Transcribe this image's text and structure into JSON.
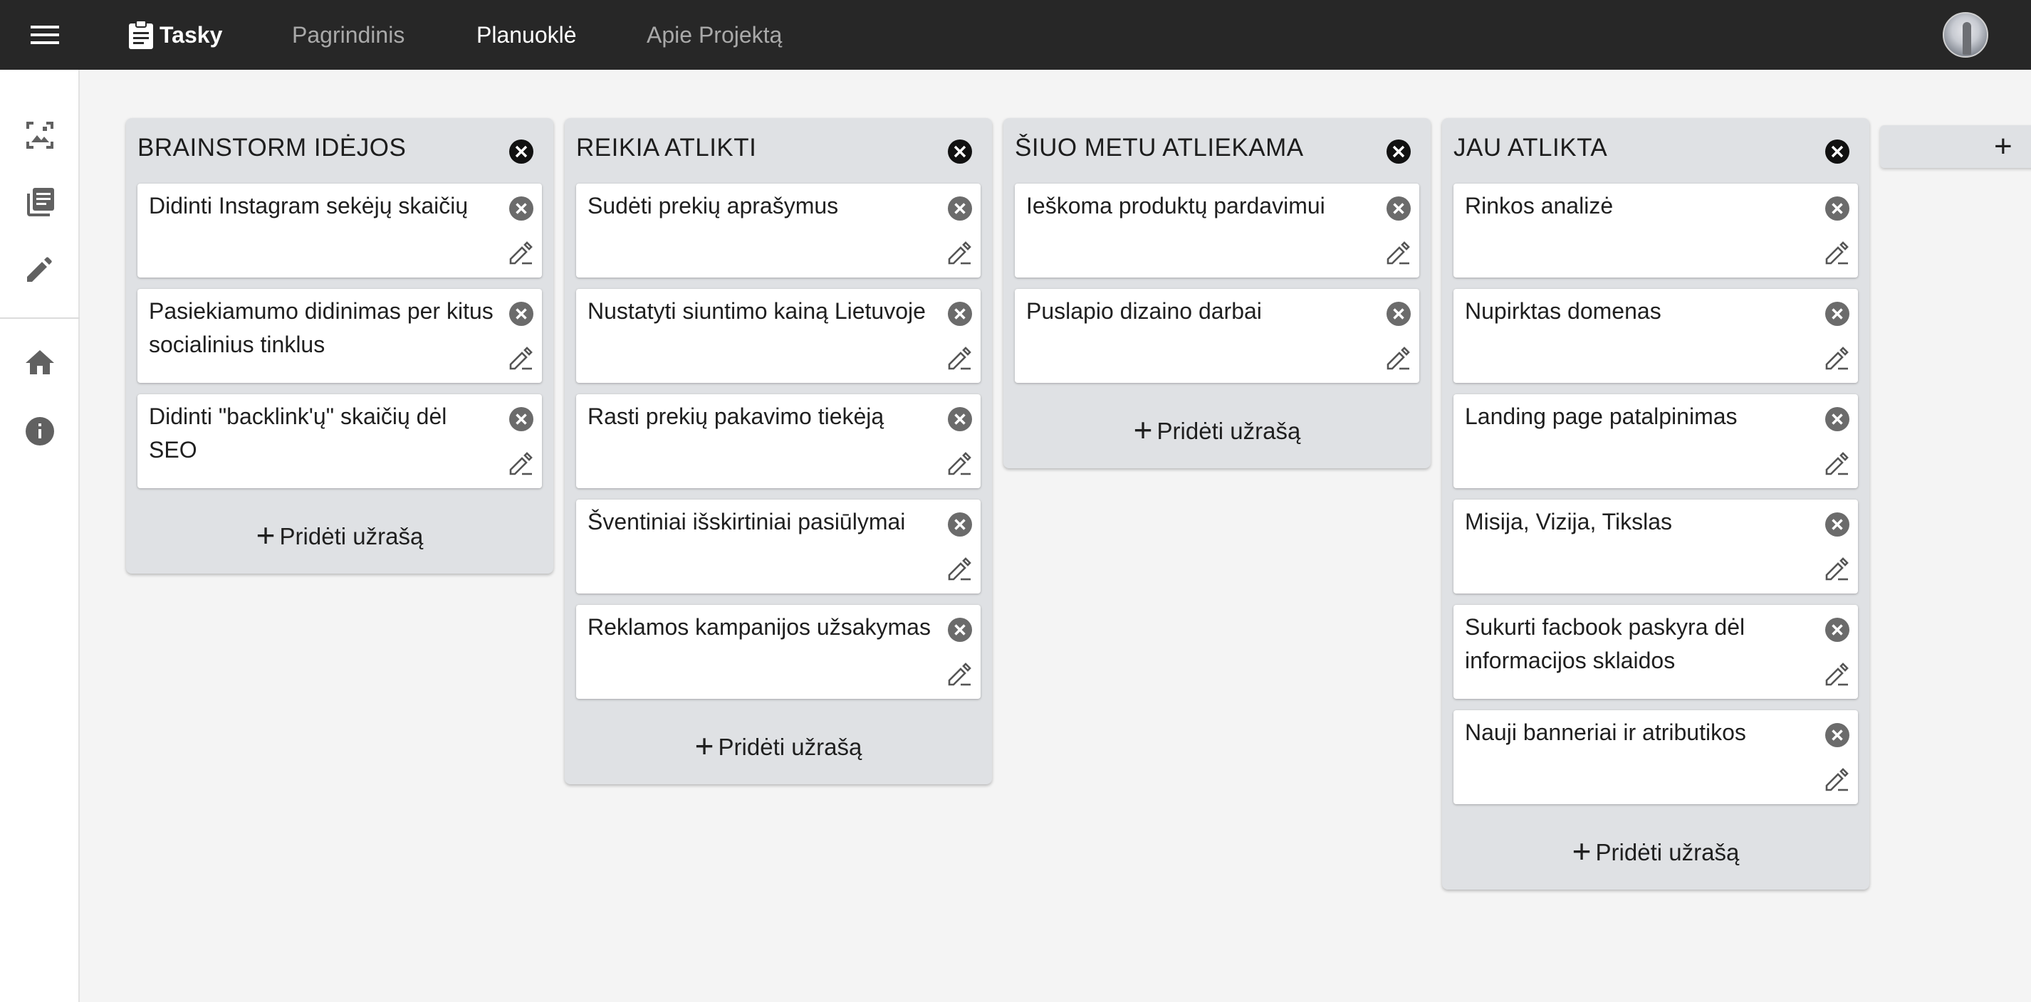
{
  "app": {
    "title": "Tasky"
  },
  "nav": [
    {
      "label": "Pagrindinis",
      "active": false
    },
    {
      "label": "Planuoklė",
      "active": true
    },
    {
      "label": "Apie Projektą",
      "active": false
    }
  ],
  "sidebar": {
    "items": [
      {
        "icon": "image-frame-icon"
      },
      {
        "icon": "library-books-icon"
      },
      {
        "icon": "pencil-icon"
      },
      {
        "icon": "home-icon"
      },
      {
        "icon": "info-icon"
      }
    ]
  },
  "board": {
    "add_note_label": "Pridėti užrašą",
    "add_column_label": "+",
    "columns": [
      {
        "title": "BRAINSTORM IDĖJOS",
        "cards": [
          "Didinti Instagram sekėjų skaičių",
          "Pasiekiamumo didinimas per kitus socialinius tinklus",
          "Didinti \"backlink'ų\" skaičių dėl SEO"
        ]
      },
      {
        "title": "REIKIA ATLIKTI",
        "cards": [
          "Sudėti prekių aprašymus",
          "Nustatyti siuntimo kainą Lietuvoje",
          "Rasti prekių pakavimo tiekėją",
          "Šventiniai išskirtiniai pasiūlymai",
          "Reklamos kampanijos užsakymas"
        ]
      },
      {
        "title": "ŠIUO METU ATLIEKAMA",
        "cards": [
          "Ieškoma produktų pardavimui",
          "Puslapio dizaino darbai"
        ]
      },
      {
        "title": "JAU ATLIKTA",
        "cards": [
          "Rinkos analizė",
          "Nupirktas domenas",
          "Landing page patalpinimas",
          "Misija, Vizija, Tikslas",
          "Sukurti facbook paskyra dėl informacijos sklaidos",
          "Nauji banneriai ir atributikos"
        ]
      }
    ]
  }
}
